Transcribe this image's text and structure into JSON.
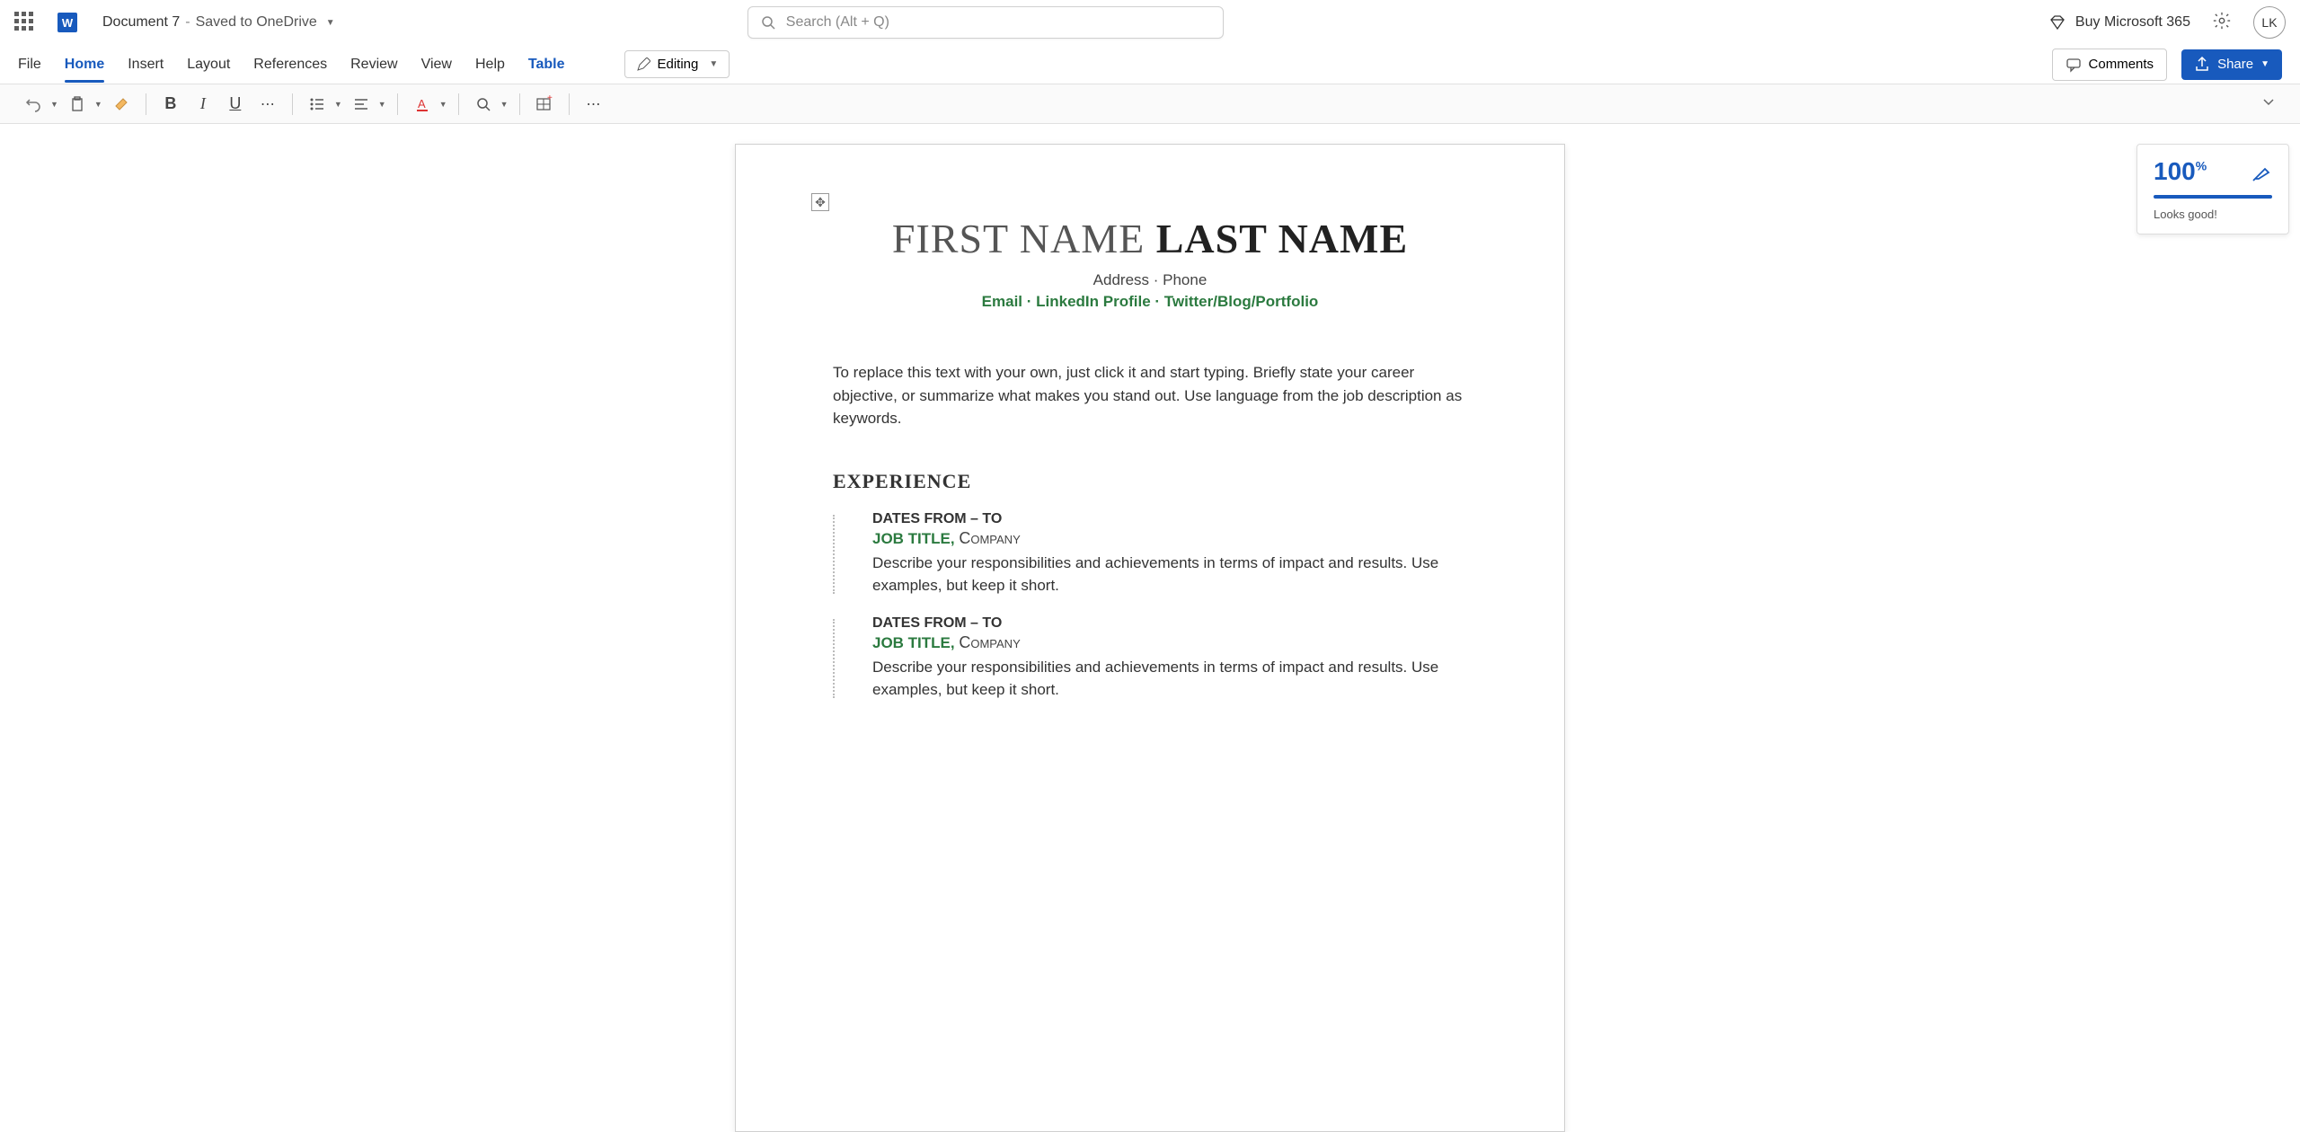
{
  "header": {
    "doc_title": "Document 7",
    "save_location": "Saved to OneDrive",
    "search_placeholder": "Search (Alt + Q)",
    "buy_label": "Buy Microsoft 365",
    "user_initials": "LK"
  },
  "tabs": {
    "file": "File",
    "home": "Home",
    "insert": "Insert",
    "layout": "Layout",
    "references": "References",
    "review": "Review",
    "view": "View",
    "help": "Help",
    "table": "Table",
    "editing": "Editing",
    "comments": "Comments",
    "share": "Share"
  },
  "document": {
    "first_name": "FIRST NAME",
    "last_name": "LAST NAME",
    "contact_line": "Address · Phone",
    "links_line": "Email · LinkedIn Profile · Twitter/Blog/Portfolio",
    "summary": "To replace this text with your own, just click it and start typing. Briefly state your career objective, or summarize what makes you stand out. Use language from the job description as keywords.",
    "experience_heading": "EXPERIENCE",
    "entries": [
      {
        "dates": "DATES FROM – TO",
        "job_title": "JOB TITLE,",
        "company": "Company",
        "desc": "Describe your responsibilities and achievements in terms of impact and results. Use examples, but keep it short."
      },
      {
        "dates": "DATES FROM – TO",
        "job_title": "JOB TITLE,",
        "company": "Company",
        "desc": "Describe your responsibilities and achievements in terms of impact and results. Use examples, but keep it short."
      }
    ]
  },
  "editor": {
    "score": "100",
    "percent": "%",
    "message": "Looks good!"
  }
}
